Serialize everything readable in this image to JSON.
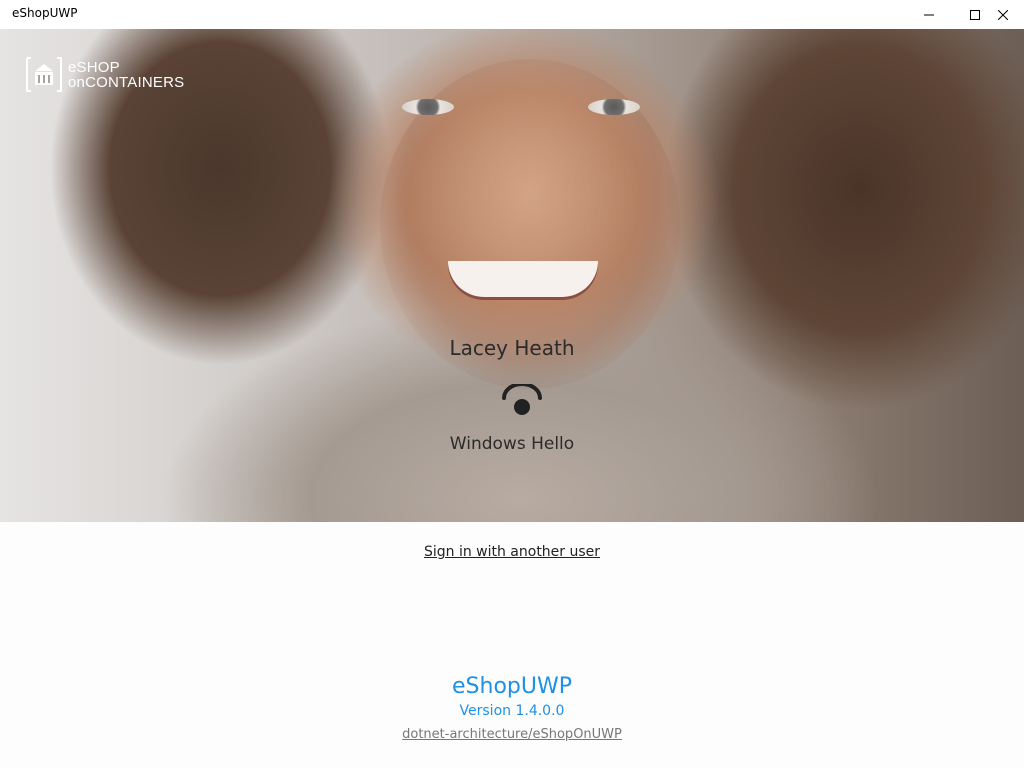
{
  "window": {
    "title": "eShopUWP",
    "controls": {
      "minimize_icon": "minimize-icon",
      "maximize_icon": "maximize-icon",
      "close_icon": "close-icon"
    }
  },
  "hero": {
    "logo": {
      "icon": "storefront-icon",
      "line1": "eSHOP",
      "line2": "onCONTAINERS"
    },
    "user_name": "Lacey Heath",
    "auth_icon": "windows-hello-icon",
    "auth_label": "Windows Hello"
  },
  "signin_other": "Sign in with another user",
  "footer": {
    "app_name": "eShopUWP",
    "version": "Version 1.4.0.0",
    "repo": "dotnet-architecture/eShopOnUWP"
  },
  "colors": {
    "accent": "#1e90e8",
    "text_dark": "#2b2b2b",
    "link_gray": "#777777"
  }
}
